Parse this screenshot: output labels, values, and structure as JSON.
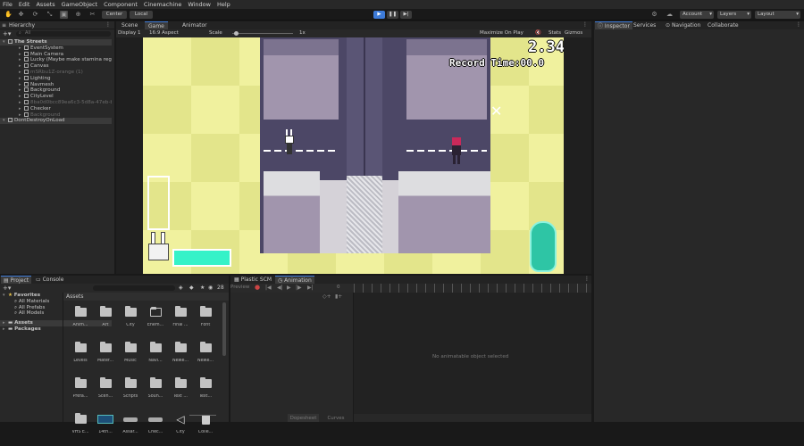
{
  "menu": [
    "File",
    "Edit",
    "Assets",
    "GameObject",
    "Component",
    "Cinemachine",
    "Window",
    "Help"
  ],
  "toolbar": {
    "pivot": "Center",
    "space": "Local",
    "account": "Account",
    "layers": "Layers",
    "layout": "Layout"
  },
  "hierarchy": {
    "tab": "Hierarchy",
    "search_placeholder": "All",
    "items": [
      {
        "label": "The Streets",
        "indent": 0,
        "bold": true
      },
      {
        "label": "EventSystem",
        "indent": 1
      },
      {
        "label": "Main Camera",
        "indent": 1
      },
      {
        "label": "Lucky (Maybe make stamina regain a",
        "indent": 1
      },
      {
        "label": "Canvas",
        "indent": 1
      },
      {
        "label": "mSRbu1Z-orange (1)",
        "indent": 1,
        "dim": true
      },
      {
        "label": "Lighting",
        "indent": 1
      },
      {
        "label": "Navmesh",
        "indent": 1
      },
      {
        "label": "Background",
        "indent": 1
      },
      {
        "label": "CityLevel",
        "indent": 1
      },
      {
        "label": "8ba0d0bcc89ea6c3-5d8a-47eb-b4",
        "indent": 1,
        "dim": true
      },
      {
        "label": "Checker",
        "indent": 1
      },
      {
        "label": "Background",
        "indent": 1,
        "dim": true
      },
      {
        "label": "DontDestroyOnLoad",
        "indent": 0
      }
    ]
  },
  "scene_tabs": [
    "Scene",
    "Game",
    "Animator"
  ],
  "game_bar": {
    "display": "Display 1",
    "aspect": "16:9 Aspect",
    "scale_label": "Scale",
    "scale_value": "1x",
    "maximize": "Maximize On Play",
    "stats": "Stats",
    "gizmos": "Gizmos"
  },
  "game_hud": {
    "timer": "2.34",
    "record": "Record Time:00.0"
  },
  "inspector_tabs": [
    "Inspector",
    "Services",
    "Navigation",
    "Collaborate"
  ],
  "project": {
    "tabs": [
      "Project",
      "Console"
    ],
    "favorites_label": "Favorites",
    "favorites": [
      "All Materials",
      "All Prefabs",
      "All Models"
    ],
    "assets_label": "Assets",
    "packages_label": "Packages",
    "breadcrumb": "Assets",
    "count": "28",
    "items": [
      {
        "label": "Anim...",
        "kind": "folder"
      },
      {
        "label": "Art",
        "kind": "folder"
      },
      {
        "label": "City",
        "kind": "folder"
      },
      {
        "label": "Enem...",
        "kind": "folder-empty"
      },
      {
        "label": "Final ...",
        "kind": "folder"
      },
      {
        "label": "Font",
        "kind": "folder"
      },
      {
        "label": "Levels",
        "kind": "folder"
      },
      {
        "label": "Mater...",
        "kind": "folder"
      },
      {
        "label": "Music",
        "kind": "folder"
      },
      {
        "label": "Navi...",
        "kind": "folder"
      },
      {
        "label": "Newe...",
        "kind": "folder"
      },
      {
        "label": "Newe...",
        "kind": "folder"
      },
      {
        "label": "Prefa...",
        "kind": "folder"
      },
      {
        "label": "Scen...",
        "kind": "folder"
      },
      {
        "label": "Scripts",
        "kind": "folder"
      },
      {
        "label": "Soun...",
        "kind": "folder"
      },
      {
        "label": "Text ...",
        "kind": "folder"
      },
      {
        "label": "Text...",
        "kind": "folder"
      },
      {
        "label": "VHS E...",
        "kind": "folder"
      },
      {
        "label": "14th...",
        "kind": "image"
      },
      {
        "label": "Assar...",
        "kind": "prefab"
      },
      {
        "label": "Chec...",
        "kind": "prefab"
      },
      {
        "label": "City",
        "kind": "unity"
      },
      {
        "label": "Colle...",
        "kind": "asset"
      }
    ]
  },
  "animation": {
    "tabs": [
      "Plastic SCM",
      "Animation"
    ],
    "preview": "Preview",
    "frame": "0",
    "empty_message": "No animatable object selected",
    "bottom_tabs": [
      "Dopesheet",
      "Curves"
    ]
  },
  "colors": {
    "accent": "#3d7bd9",
    "game_bg": "#f0f19e",
    "checker": "#e3e58b",
    "road": "#4c4766",
    "building_top": "#7c738f",
    "building_bottom": "#a195ad",
    "stamina": "#35f2c8",
    "crystal": "#2ec5a5"
  }
}
